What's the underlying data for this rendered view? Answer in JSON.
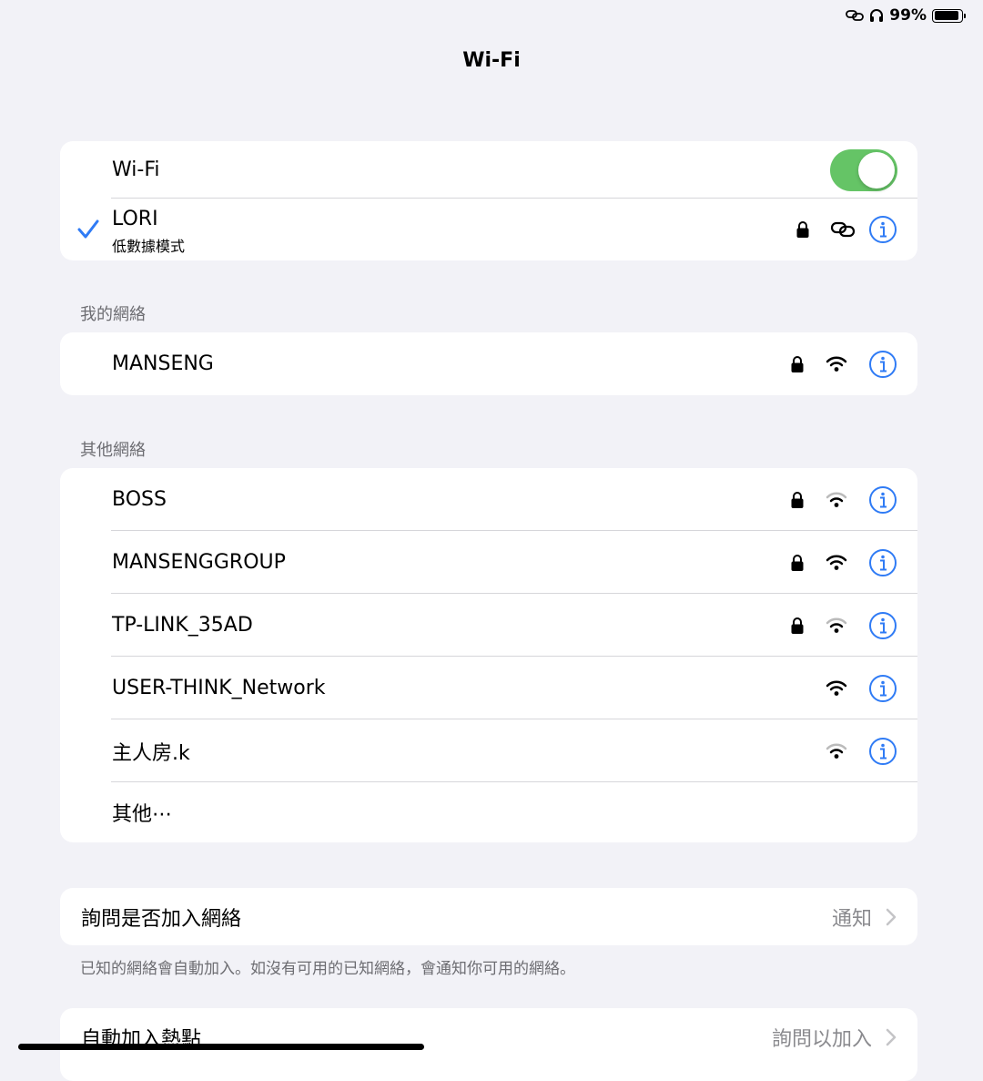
{
  "status_bar": {
    "battery": "99%"
  },
  "nav": {
    "title": "Wi-Fi"
  },
  "wifi": {
    "toggle_label": "Wi-Fi",
    "toggle_on": true,
    "connected": {
      "name": "LORI",
      "subtitle": "低數據模式"
    }
  },
  "my_networks": {
    "header": "我的網絡",
    "items": [
      {
        "name": "MANSENG",
        "secured": true
      }
    ]
  },
  "other_networks": {
    "header": "其他網絡",
    "items": [
      {
        "name": "BOSS",
        "secured": true
      },
      {
        "name": "MANSENGGROUP",
        "secured": true
      },
      {
        "name": "TP-LINK_35AD",
        "secured": true
      },
      {
        "name": "USER-THINK_Network",
        "secured": false
      },
      {
        "name": "主人房.k",
        "secured": false
      }
    ],
    "other_label": "其他⋯"
  },
  "ask_to_join": {
    "label": "詢問是否加入網絡",
    "value": "通知",
    "footnote": "已知的網絡會自動加入。如沒有可用的已知網絡，會通知你可用的網絡。"
  },
  "auto_join_hotspot": {
    "label": "自動加入熱點",
    "value": "詢問以加入"
  },
  "colors": {
    "accent": "#2f7bf5",
    "toggle_on": "#65c466",
    "background": "#f2f2f7"
  }
}
